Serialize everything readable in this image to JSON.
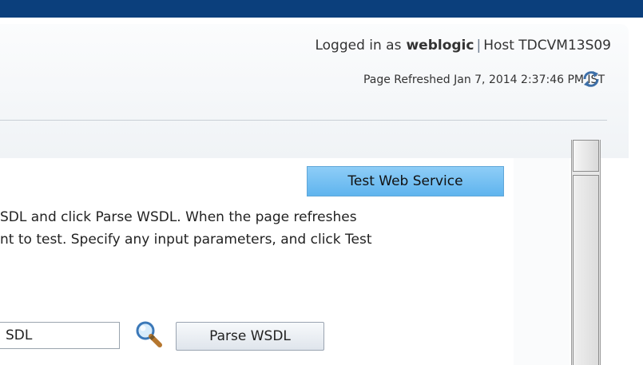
{
  "header": {
    "logged_in_label": "Logged in as",
    "username": "weblogic",
    "separator": "|",
    "host_label": "Host TDCVM13S09",
    "page_refreshed": "Page Refreshed Jan 7, 2014 2:37:46 PM IST"
  },
  "main": {
    "test_button_label": "Test Web Service",
    "instructions_line1": "SDL and click Parse WSDL. When the page refreshes",
    "instructions_line2": "nt to test. Specify any input parameters, and click Test",
    "wsdl_input_value": "SDL",
    "parse_button_label": "Parse WSDL"
  },
  "icons": {
    "refresh": "refresh-icon",
    "search": "search-icon"
  },
  "colors": {
    "topbar": "#0b3f7c",
    "accent_button": "#6fbff2"
  }
}
